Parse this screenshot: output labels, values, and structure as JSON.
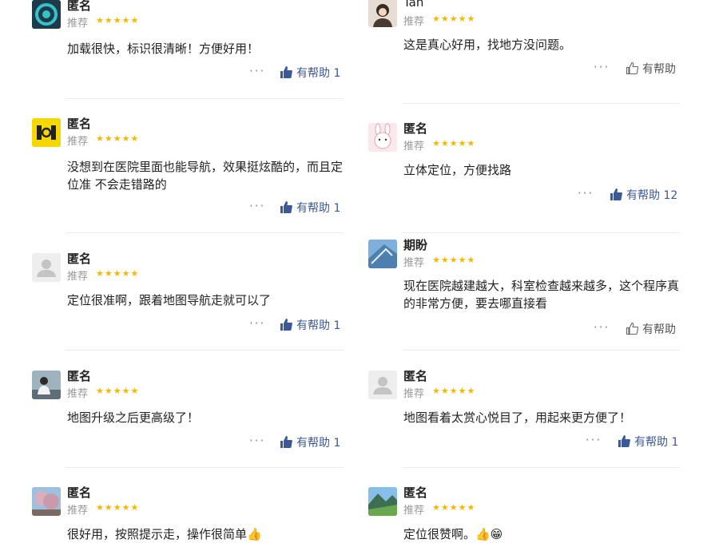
{
  "colors": {
    "star": "#f5b800",
    "accent": "#3b5998",
    "muted": "#999999"
  },
  "stars_glyph": "★★★★★",
  "more_glyph": "···",
  "helpful_label": "有帮助",
  "left": [
    {
      "name": "匿名",
      "rec": "推荐",
      "text": "加载很快，标识很清晰！方便好用！",
      "count": "1",
      "avatar": "teal-logo"
    },
    {
      "name": "匿名",
      "rec": "推荐",
      "text": "没想到在医院里面也能导航，效果挺炫酷的，而且定位准 不会走错路的",
      "count": "1",
      "avatar": "yellow-logo"
    },
    {
      "name": "匿名",
      "rec": "推荐",
      "text": "定位很准啊，跟着地图导航走就可以了",
      "count": "1",
      "avatar": "default-person"
    },
    {
      "name": "匿名",
      "rec": "推荐",
      "text": "地图升级之后更高级了！",
      "count": "1",
      "avatar": "photo-person"
    },
    {
      "name": "匿名",
      "rec": "推荐",
      "text": "很好用，按照提示走，操作很简单👍",
      "count": "",
      "avatar": "cherry-blossom"
    }
  ],
  "right": [
    {
      "name": "Tan",
      "rec": "推荐",
      "text": "这是真心好用，找地方没问题。",
      "count": "",
      "avatar": "photo-girl"
    },
    {
      "name": "匿名",
      "rec": "推荐",
      "text": "立体定位，方便找路",
      "count": "12",
      "avatar": "bunny-cartoon"
    },
    {
      "name": "期盼",
      "rec": "推荐",
      "text": "现在医院越建越大，科室检查越来越多，这个程序真的非常方便，要去哪直接看",
      "count": "",
      "avatar": "sky-photo"
    },
    {
      "name": "匿名",
      "rec": "推荐",
      "text": "地图看着太赏心悦目了，用起来更方便了！",
      "count": "1",
      "avatar": "default-person"
    },
    {
      "name": "匿名",
      "rec": "推荐",
      "text": "定位很赞啊。👍😁",
      "count": "",
      "avatar": "mountain-landscape"
    }
  ]
}
